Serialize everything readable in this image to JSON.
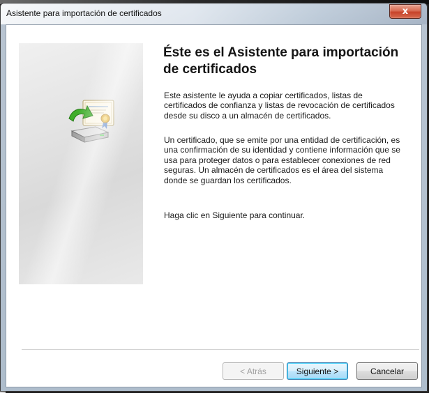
{
  "window": {
    "title": "Asistente para importación de certificados",
    "close_glyph": "x"
  },
  "background": {
    "partial_text": "p"
  },
  "wizard": {
    "heading": "Éste es el Asistente para importación de certificados",
    "paragraph1": "Este asistente le ayuda a copiar certificados, listas de certificados de confianza y listas de revocación de certificados desde su disco a un almacén de certificados.",
    "paragraph2": "Un certificado, que se emite por una entidad de certificación, es una confirmación de su identidad y contiene información que se usa para proteger datos o para establecer conexiones de red seguras. Un almacén de certificados es el área del sistema donde se guardan los certificados.",
    "paragraph3": "Haga clic en Siguiente para continuar.",
    "icon": "certificate-import-icon"
  },
  "buttons": {
    "back": "< Atrás",
    "next": "Siguiente >",
    "cancel": "Cancelar"
  },
  "colors": {
    "close_red": "#c7432a",
    "default_button_border": "#3c7fb1"
  }
}
